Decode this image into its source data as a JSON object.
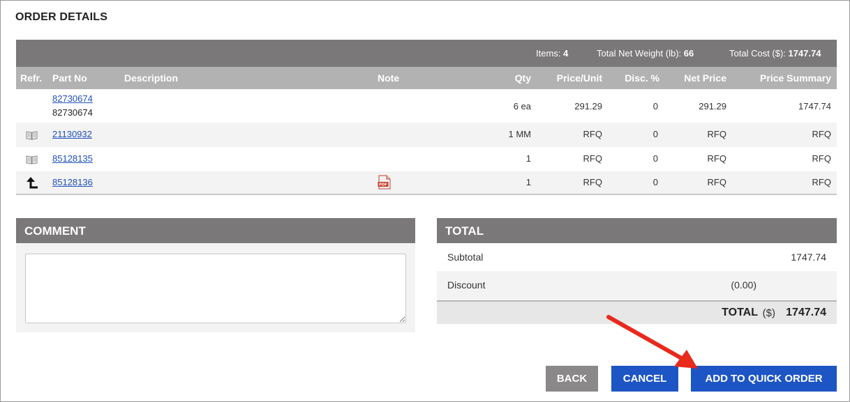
{
  "page": {
    "title": "ORDER DETAILS"
  },
  "summary": {
    "items_label": "Items:",
    "items_value": "4",
    "weight_label": "Total Net Weight (lb):",
    "weight_value": "66",
    "cost_label": "Total Cost ($):",
    "cost_value": "1747.74"
  },
  "columns": {
    "refr": "Refr.",
    "part_no": "Part No",
    "description": "Description",
    "note": "Note",
    "qty": "Qty",
    "price_unit": "Price/Unit",
    "disc": "Disc. %",
    "net_price": "Net Price",
    "price_summary": "Price Summary"
  },
  "rows": [
    {
      "refr_icon": "",
      "part_no": "82730674",
      "part_sub": "82730674",
      "note_icon": "",
      "qty": "6 ea",
      "price_unit": "291.29",
      "disc": "0",
      "net_price": "291.29",
      "price_summary": "1747.74"
    },
    {
      "refr_icon": "book-icon",
      "part_no": "21130932",
      "part_sub": "",
      "note_icon": "",
      "qty": "1 MM",
      "price_unit": "RFQ",
      "disc": "0",
      "net_price": "RFQ",
      "price_summary": "RFQ"
    },
    {
      "refr_icon": "book-icon",
      "part_no": "85128135",
      "part_sub": "",
      "note_icon": "",
      "qty": "1",
      "price_unit": "RFQ",
      "disc": "0",
      "net_price": "RFQ",
      "price_summary": "RFQ"
    },
    {
      "refr_icon": "arrow-up-left-icon",
      "part_no": "85128136",
      "part_sub": "",
      "note_icon": "pdf-icon",
      "qty": "1",
      "price_unit": "RFQ",
      "disc": "0",
      "net_price": "RFQ",
      "price_summary": "RFQ"
    }
  ],
  "comment": {
    "title": "COMMENT",
    "value": ""
  },
  "total": {
    "title": "TOTAL",
    "subtotal_label": "Subtotal",
    "subtotal_value": "1747.74",
    "discount_label": "Discount",
    "discount_value": "(0.00)",
    "grand_label": "TOTAL",
    "grand_currency": "($)",
    "grand_value": "1747.74"
  },
  "buttons": {
    "back": "BACK",
    "cancel": "CANCEL",
    "add": "ADD TO QUICK ORDER"
  },
  "colors": {
    "header_dark": "#7a7878",
    "header_light": "#b3b2b2",
    "button_primary": "#1d55c4",
    "button_secondary": "#8a8888",
    "link": "#1f4fb8",
    "annotation_arrow": "#e8291c"
  }
}
